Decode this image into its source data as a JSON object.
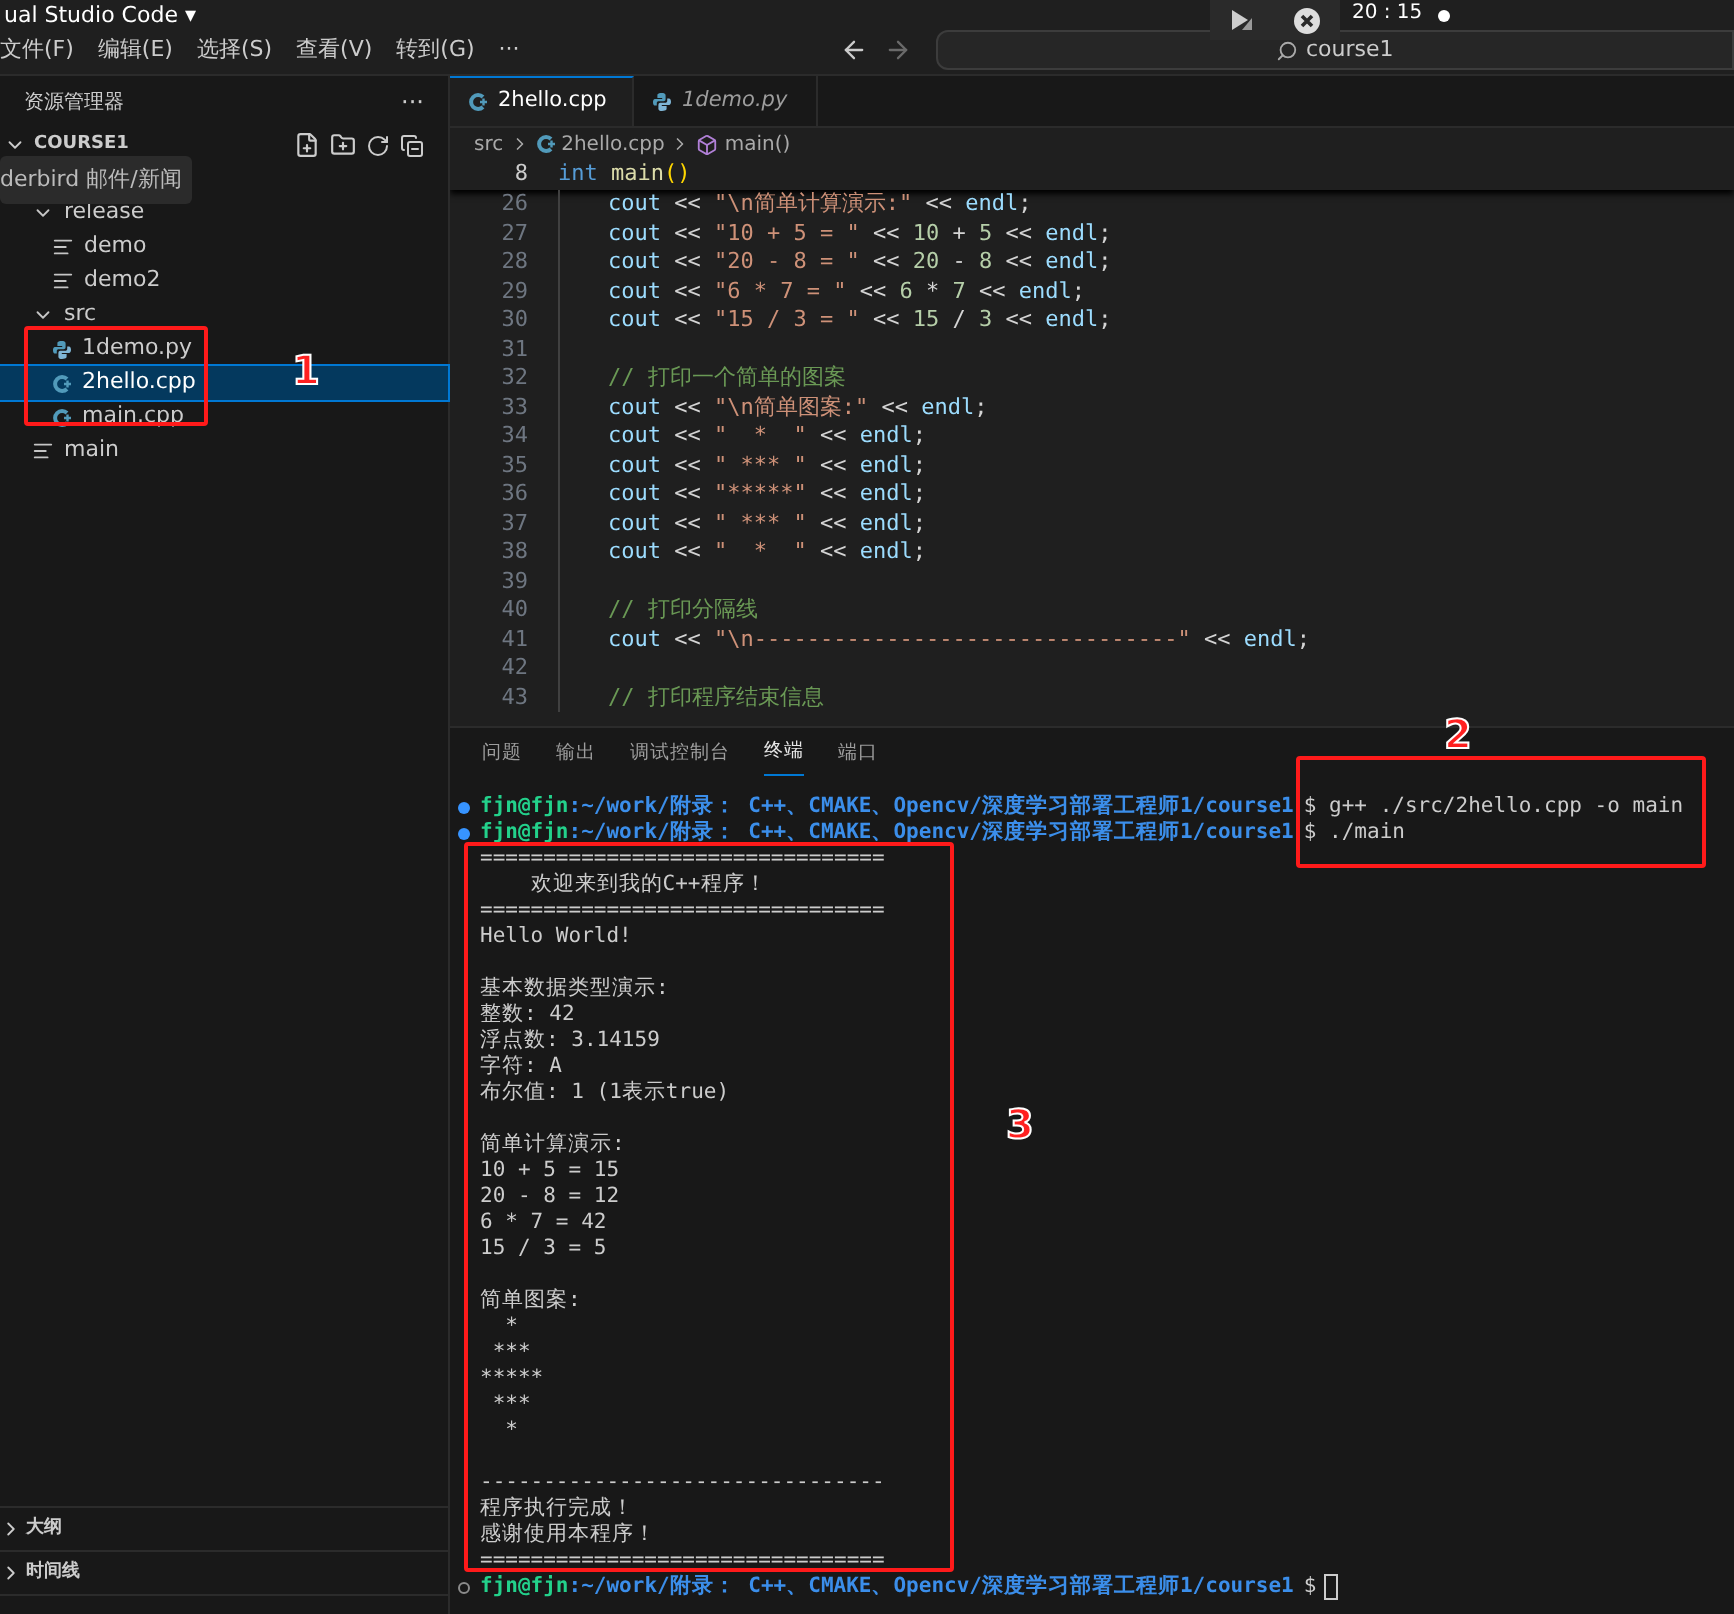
{
  "title_bar": {
    "title": "ual Studio Code ▾",
    "clock": "20 : 15"
  },
  "menu_bar": {
    "items": [
      "文件(F)",
      "编辑(E)",
      "选择(S)",
      "查看(V)",
      "转到(G)",
      "···"
    ],
    "search": {
      "value": "course1"
    }
  },
  "tooltip": "derbird 邮件/新闻",
  "sidebar": {
    "title": "资源管理器",
    "more": "···",
    "root": "COURSE1",
    "root_expanded": true,
    "tree": [
      {
        "name": "release",
        "kind": "folder",
        "expanded": true,
        "selected": false,
        "children": [
          {
            "name": "demo",
            "kind": "binary",
            "selected": false
          },
          {
            "name": "demo2",
            "kind": "binary",
            "selected": false
          }
        ]
      },
      {
        "name": "src",
        "kind": "folder",
        "expanded": true,
        "selected": false,
        "children": [
          {
            "name": "1demo.py",
            "kind": "python",
            "selected": false
          },
          {
            "name": "2hello.cpp",
            "kind": "cpp",
            "selected": true
          },
          {
            "name": "main.cpp",
            "kind": "cpp",
            "selected": false
          }
        ]
      },
      {
        "name": "main",
        "kind": "binary",
        "selected": false
      }
    ],
    "sections": [
      "大纲",
      "时间线"
    ]
  },
  "editor": {
    "tabs": [
      {
        "label": "2hello.cpp",
        "kind": "cpp",
        "selected": true,
        "preview": false
      },
      {
        "label": "1demo.py",
        "kind": "python",
        "selected": false,
        "preview": true
      }
    ],
    "breadcrumb": [
      "src",
      "2hello.cpp",
      "main()"
    ],
    "sticky": {
      "n": "8",
      "tokens": [
        {
          "kind": "keyword",
          "text": "int"
        },
        {
          "kind": "function",
          "text": " main"
        },
        {
          "kind": "paren",
          "text": "()"
        }
      ]
    },
    "lines": [
      {
        "n": "26",
        "tokens": [
          {
            "kind": "ident",
            "text": "cout"
          },
          {
            "kind": "op",
            "text": " << "
          },
          {
            "kind": "string",
            "text": "\"\\n简单计算演示:\""
          },
          {
            "kind": "op",
            "text": " << "
          },
          {
            "kind": "ident",
            "text": "endl"
          },
          {
            "kind": "op",
            "text": ";"
          }
        ]
      },
      {
        "n": "27",
        "tokens": [
          {
            "kind": "ident",
            "text": "cout"
          },
          {
            "kind": "op",
            "text": " << "
          },
          {
            "kind": "string",
            "text": "\"10 + 5 = \""
          },
          {
            "kind": "op",
            "text": " << "
          },
          {
            "kind": "number",
            "text": "10"
          },
          {
            "kind": "op",
            "text": " + "
          },
          {
            "kind": "number",
            "text": "5"
          },
          {
            "kind": "op",
            "text": " << "
          },
          {
            "kind": "ident",
            "text": "endl"
          },
          {
            "kind": "op",
            "text": ";"
          }
        ]
      },
      {
        "n": "28",
        "tokens": [
          {
            "kind": "ident",
            "text": "cout"
          },
          {
            "kind": "op",
            "text": " << "
          },
          {
            "kind": "string",
            "text": "\"20 - 8 = \""
          },
          {
            "kind": "op",
            "text": " << "
          },
          {
            "kind": "number",
            "text": "20"
          },
          {
            "kind": "op",
            "text": " - "
          },
          {
            "kind": "number",
            "text": "8"
          },
          {
            "kind": "op",
            "text": " << "
          },
          {
            "kind": "ident",
            "text": "endl"
          },
          {
            "kind": "op",
            "text": ";"
          }
        ]
      },
      {
        "n": "29",
        "tokens": [
          {
            "kind": "ident",
            "text": "cout"
          },
          {
            "kind": "op",
            "text": " << "
          },
          {
            "kind": "string",
            "text": "\"6 * 7 = \""
          },
          {
            "kind": "op",
            "text": " << "
          },
          {
            "kind": "number",
            "text": "6"
          },
          {
            "kind": "op",
            "text": " * "
          },
          {
            "kind": "number",
            "text": "7"
          },
          {
            "kind": "op",
            "text": " << "
          },
          {
            "kind": "ident",
            "text": "endl"
          },
          {
            "kind": "op",
            "text": ";"
          }
        ]
      },
      {
        "n": "30",
        "tokens": [
          {
            "kind": "ident",
            "text": "cout"
          },
          {
            "kind": "op",
            "text": " << "
          },
          {
            "kind": "string",
            "text": "\"15 / 3 = \""
          },
          {
            "kind": "op",
            "text": " << "
          },
          {
            "kind": "number",
            "text": "15"
          },
          {
            "kind": "op",
            "text": " / "
          },
          {
            "kind": "number",
            "text": "3"
          },
          {
            "kind": "op",
            "text": " << "
          },
          {
            "kind": "ident",
            "text": "endl"
          },
          {
            "kind": "op",
            "text": ";"
          }
        ]
      },
      {
        "n": "31"
      },
      {
        "n": "32",
        "tokens": [
          {
            "kind": "comment",
            "text": "// 打印一个简单的图案"
          }
        ]
      },
      {
        "n": "33",
        "tokens": [
          {
            "kind": "ident",
            "text": "cout"
          },
          {
            "kind": "op",
            "text": " << "
          },
          {
            "kind": "string",
            "text": "\"\\n简单图案:\""
          },
          {
            "kind": "op",
            "text": " << "
          },
          {
            "kind": "ident",
            "text": "endl"
          },
          {
            "kind": "op",
            "text": ";"
          }
        ]
      },
      {
        "n": "34",
        "tokens": [
          {
            "kind": "ident",
            "text": "cout"
          },
          {
            "kind": "op",
            "text": " << "
          },
          {
            "kind": "string",
            "text": "\"  *  \""
          },
          {
            "kind": "op",
            "text": " << "
          },
          {
            "kind": "ident",
            "text": "endl"
          },
          {
            "kind": "op",
            "text": ";"
          }
        ]
      },
      {
        "n": "35",
        "tokens": [
          {
            "kind": "ident",
            "text": "cout"
          },
          {
            "kind": "op",
            "text": " << "
          },
          {
            "kind": "string",
            "text": "\" *** \""
          },
          {
            "kind": "op",
            "text": " << "
          },
          {
            "kind": "ident",
            "text": "endl"
          },
          {
            "kind": "op",
            "text": ";"
          }
        ]
      },
      {
        "n": "36",
        "tokens": [
          {
            "kind": "ident",
            "text": "cout"
          },
          {
            "kind": "op",
            "text": " << "
          },
          {
            "kind": "string",
            "text": "\"*****\""
          },
          {
            "kind": "op",
            "text": " << "
          },
          {
            "kind": "ident",
            "text": "endl"
          },
          {
            "kind": "op",
            "text": ";"
          }
        ]
      },
      {
        "n": "37",
        "tokens": [
          {
            "kind": "ident",
            "text": "cout"
          },
          {
            "kind": "op",
            "text": " << "
          },
          {
            "kind": "string",
            "text": "\" *** \""
          },
          {
            "kind": "op",
            "text": " << "
          },
          {
            "kind": "ident",
            "text": "endl"
          },
          {
            "kind": "op",
            "text": ";"
          }
        ]
      },
      {
        "n": "38",
        "tokens": [
          {
            "kind": "ident",
            "text": "cout"
          },
          {
            "kind": "op",
            "text": " << "
          },
          {
            "kind": "string",
            "text": "\"  *  \""
          },
          {
            "kind": "op",
            "text": " << "
          },
          {
            "kind": "ident",
            "text": "endl"
          },
          {
            "kind": "op",
            "text": ";"
          }
        ]
      },
      {
        "n": "39"
      },
      {
        "n": "40",
        "tokens": [
          {
            "kind": "comment",
            "text": "// 打印分隔线"
          }
        ]
      },
      {
        "n": "41",
        "tokens": [
          {
            "kind": "ident",
            "text": "cout"
          },
          {
            "kind": "op",
            "text": " << "
          },
          {
            "kind": "string",
            "text": "\"\\n--------------------------------\""
          },
          {
            "kind": "op",
            "text": " << "
          },
          {
            "kind": "ident",
            "text": "endl"
          },
          {
            "kind": "op",
            "text": ";"
          }
        ]
      },
      {
        "n": "42"
      },
      {
        "n": "43",
        "tokens": [
          {
            "kind": "comment",
            "text": "// 打印程序结束信息"
          }
        ]
      }
    ]
  },
  "panel": {
    "tabs": [
      {
        "label": "问题",
        "selected": false
      },
      {
        "label": "输出",
        "selected": false
      },
      {
        "label": "调试控制台",
        "selected": false
      },
      {
        "label": "终端",
        "selected": true
      },
      {
        "label": "端口",
        "selected": false
      }
    ],
    "prompts": [
      {
        "user": "fjn@fjn",
        "path": ":~/work/附录： C++、CMAKE、Opencv/深度学习部署工程师1/course1",
        "command": "$ g++ ./src/2hello.cpp -o main",
        "kind": "finished"
      },
      {
        "user": "fjn@fjn",
        "path": ":~/work/附录： C++、CMAKE、Opencv/深度学习部署工程师1/course1",
        "command": "$ ./main",
        "kind": "finished"
      }
    ],
    "output_blocks": [
      [
        "================================",
        "    欢迎来到我的C++程序！",
        "================================",
        "Hello World!"
      ],
      [
        "基本数据类型演示:",
        "整数: 42",
        "浮点数: 3.14159",
        "字符: A",
        "布尔值: 1 (1表示true)"
      ],
      [
        "简单计算演示:",
        "10 + 5 = 15",
        "20 - 8 = 12",
        "6 * 7 = 42",
        "15 / 3 = 5"
      ],
      [
        "简单图案:",
        "  *\n ***\n*****\n ***\n  *"
      ],
      [
        "--------------------------------",
        "程序执行完成！",
        "感谢使用本程序！",
        "================================"
      ]
    ],
    "last_prompt": {
      "user": "fjn@fjn",
      "path": ":~/work/附录： C++、CMAKE、Opencv/深度学习部署工程师1/course1",
      "command": "$",
      "kind": "idle"
    }
  },
  "annotations": [
    {
      "label": "1"
    },
    {
      "label": "2"
    },
    {
      "label": "3"
    }
  ]
}
